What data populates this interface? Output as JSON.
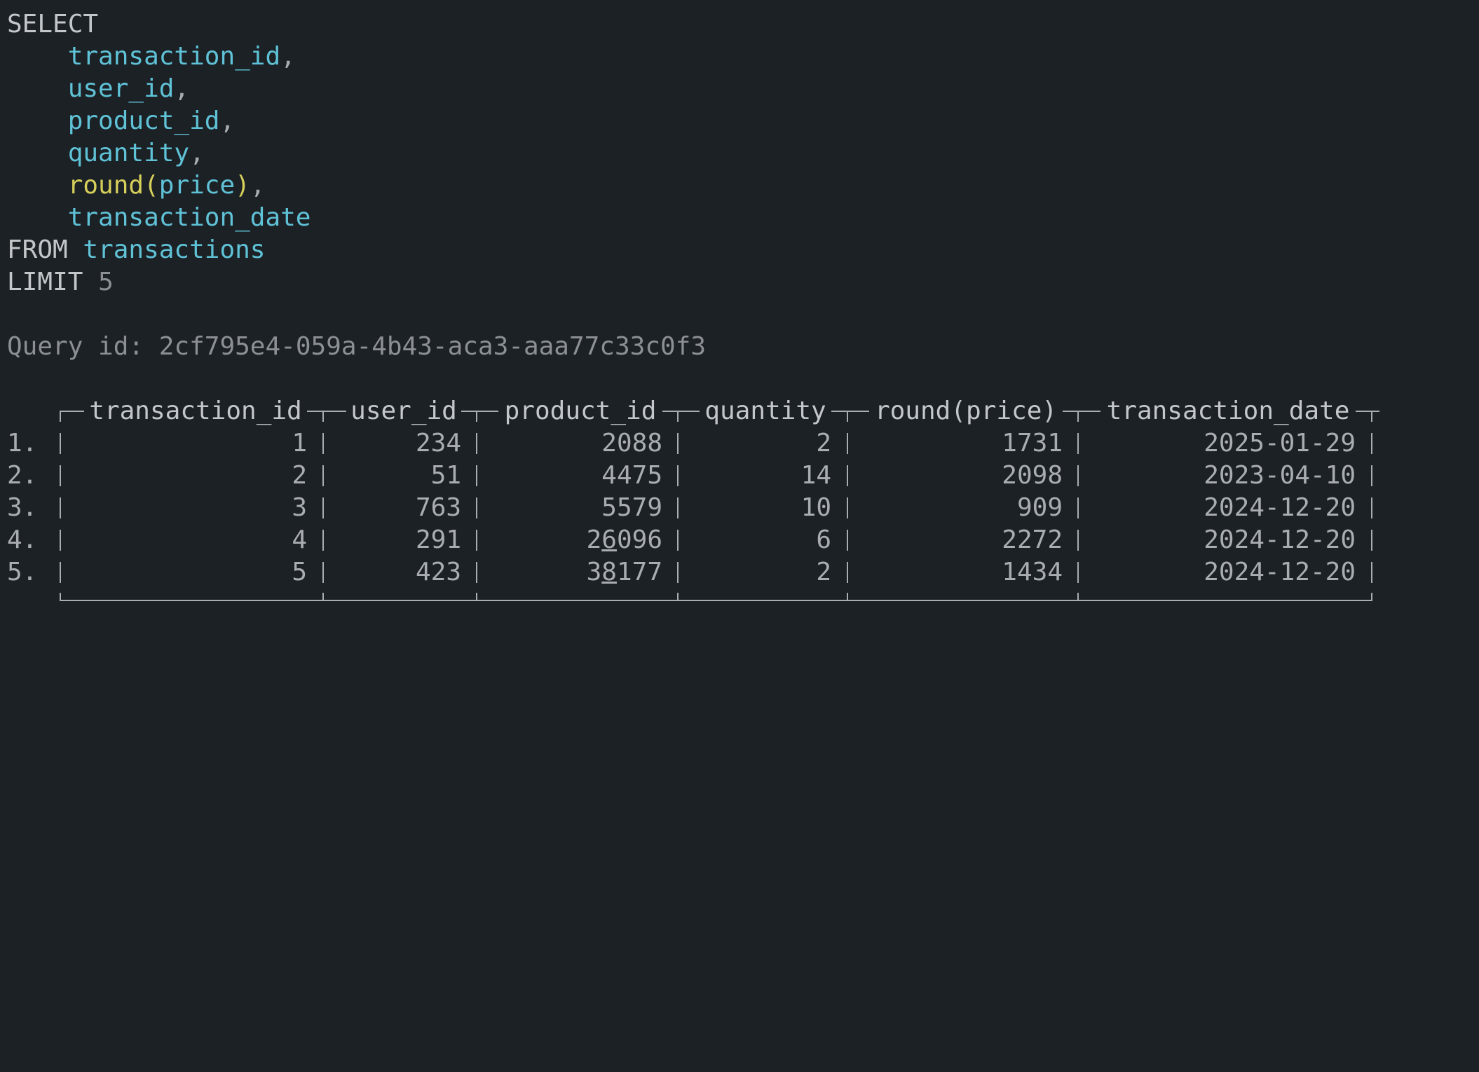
{
  "query": {
    "select_kw": "SELECT",
    "columns": [
      {
        "name": "transaction_id",
        "suffix": ","
      },
      {
        "name": "user_id",
        "suffix": ","
      },
      {
        "name": "product_id",
        "suffix": ","
      },
      {
        "name": "quantity",
        "suffix": ","
      },
      {
        "name": "price",
        "fn": "round",
        "suffix": ","
      },
      {
        "name": "transaction_date",
        "suffix": ""
      }
    ],
    "from_kw": "FROM",
    "table": "transactions",
    "limit_kw": "LIMIT",
    "limit_val": "5"
  },
  "query_id_label": "Query id:",
  "query_id": "2cf795e4-059a-4b43-aca3-aaa77c33c0f3",
  "result": {
    "headers": [
      "transaction_id",
      "user_id",
      "product_id",
      "quantity",
      "round(price)",
      "transaction_date"
    ],
    "rows": [
      {
        "num": "1.",
        "cells": [
          "1",
          "234",
          "2088",
          "2",
          "1731",
          "2025-01-29"
        ]
      },
      {
        "num": "2.",
        "cells": [
          "2",
          "51",
          "4475",
          "14",
          "2098",
          "2023-04-10"
        ]
      },
      {
        "num": "3.",
        "cells": [
          "3",
          "763",
          "5579",
          "10",
          "909",
          "2024-12-20"
        ]
      },
      {
        "num": "4.",
        "cells": [
          "4",
          "291",
          "26096",
          "6",
          "2272",
          "2024-12-20"
        ]
      },
      {
        "num": "5.",
        "cells": [
          "5",
          "423",
          "38177",
          "2",
          "1434",
          "2024-12-20"
        ]
      }
    ]
  }
}
